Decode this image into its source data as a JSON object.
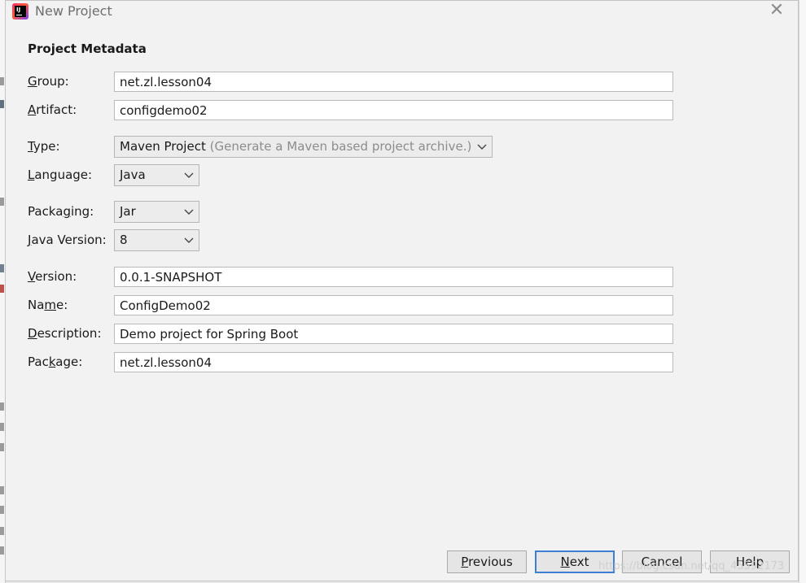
{
  "window": {
    "title": "New Project"
  },
  "section_title": "Project Metadata",
  "fields": {
    "group": {
      "label_pre": "",
      "label_key": "G",
      "label_post": "roup:",
      "value": "net.zl.lesson04"
    },
    "artifact": {
      "label_pre": "",
      "label_key": "A",
      "label_post": "rtifact:",
      "value": "configdemo02"
    },
    "version": {
      "label_pre": "",
      "label_key": "V",
      "label_post": "ersion:",
      "value": "0.0.1-SNAPSHOT"
    },
    "name": {
      "label_pre": "Na",
      "label_key": "m",
      "label_post": "e:",
      "value": "ConfigDemo02"
    },
    "description": {
      "label_pre": "",
      "label_key": "D",
      "label_post": "escription:",
      "value": "Demo project for Spring Boot"
    },
    "package": {
      "label_pre": "Pac",
      "label_key": "k",
      "label_post": "age:",
      "value": "net.zl.lesson04"
    }
  },
  "selects": {
    "type": {
      "label_pre": "",
      "label_key": "T",
      "label_post": "ype:",
      "value": "Maven Project",
      "hint": "(Generate a Maven based project archive.)"
    },
    "language": {
      "label_pre": "",
      "label_key": "L",
      "label_post": "anguage:",
      "value": "Java"
    },
    "packaging": {
      "label_pre": "Packa",
      "label_key": "g",
      "label_post": "ing:",
      "value": "Jar"
    },
    "java_version": {
      "label_pre": "",
      "label_key": "J",
      "label_post": "ava Version:",
      "value": "8"
    }
  },
  "buttons": {
    "previous": {
      "key": "P",
      "rest": "revious"
    },
    "next": {
      "key": "N",
      "rest": "ext"
    },
    "cancel": {
      "label": "Cancel"
    },
    "help": {
      "label": "Help"
    }
  },
  "watermark": "https://blog.csdn.net/qq_45592173",
  "icons": {
    "close": "close-icon",
    "app": "intellij-app-icon",
    "dropdown": "chevron-down-icon"
  },
  "colors": {
    "dialog_bg": "#f2f2f2",
    "primary_border": "#3d7fd1"
  }
}
